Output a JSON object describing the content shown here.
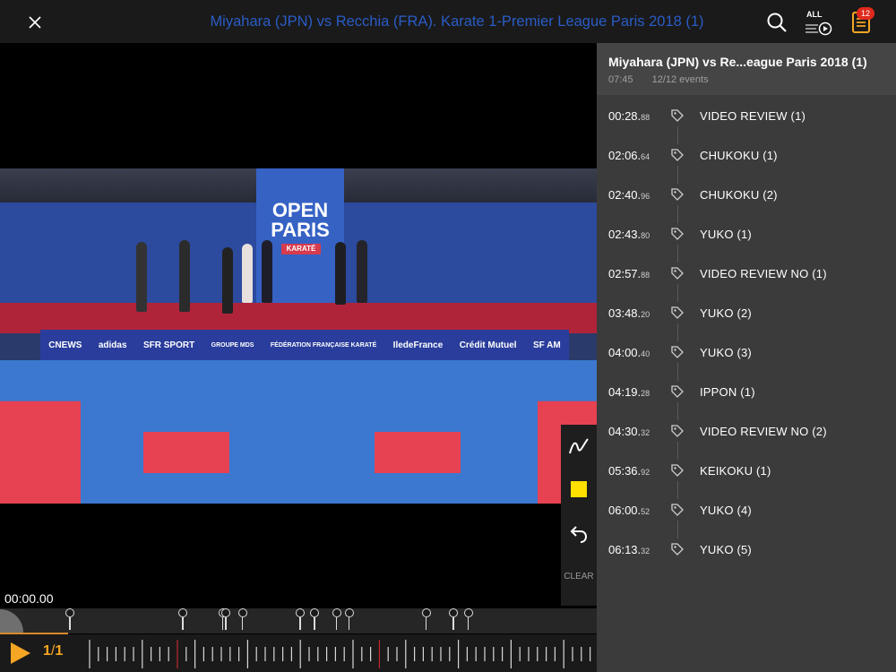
{
  "header": {
    "title": "Miyahara (JPN) vs Recchia (FRA). Karate 1-Premier League Paris 2018 (1)",
    "all_label": "ALL",
    "badge_count": "12",
    "title_color": "#2a5cc6"
  },
  "icons": {
    "close": "close-icon",
    "search": "search-icon",
    "all": "play-all-icon",
    "list": "event-list-icon"
  },
  "video": {
    "banner_line1": "OPEN",
    "banner_line2": "PARIS",
    "banner_sub": "KARATÉ",
    "ads": [
      "CNEWS",
      "adidas",
      "SFR SPORT",
      "GROUPE MDS",
      "FÉDÉRATION FRANÇAISE KARATÉ",
      "IledeFrance",
      "Crédit Mutuel",
      "SF AM"
    ]
  },
  "tools": {
    "clear_label": "CLEAR"
  },
  "player": {
    "current_time": "00:00.00",
    "speed_num": "1",
    "speed_den": "1",
    "progress_color": "#d88a2a",
    "accent": "#f5a623"
  },
  "panel": {
    "title": "Miyahara (JPN) vs Re...eague Paris 2018 (1)",
    "duration": "07:45",
    "events_count": "12/12 events",
    "events": [
      {
        "time": "00:28",
        "ms": "88",
        "label": "VIDEO REVIEW (1)"
      },
      {
        "time": "02:06",
        "ms": "64",
        "label": "CHUKOKU (1)"
      },
      {
        "time": "02:40",
        "ms": "96",
        "label": "CHUKOKU (2)"
      },
      {
        "time": "02:43",
        "ms": "80",
        "label": "YUKO (1)"
      },
      {
        "time": "02:57",
        "ms": "88",
        "label": "VIDEO REVIEW NO (1)"
      },
      {
        "time": "03:48",
        "ms": "20",
        "label": "YUKO (2)"
      },
      {
        "time": "04:00",
        "ms": "40",
        "label": "YUKO (3)"
      },
      {
        "time": "04:19",
        "ms": "28",
        "label": "IPPON (1)"
      },
      {
        "time": "04:30",
        "ms": "32",
        "label": "VIDEO REVIEW NO (2)"
      },
      {
        "time": "05:36",
        "ms": "92",
        "label": "KEIKOKU (1)"
      },
      {
        "time": "06:00",
        "ms": "52",
        "label": "YUKO (4)"
      },
      {
        "time": "06:13",
        "ms": "32",
        "label": "YUKO (5)"
      }
    ]
  }
}
